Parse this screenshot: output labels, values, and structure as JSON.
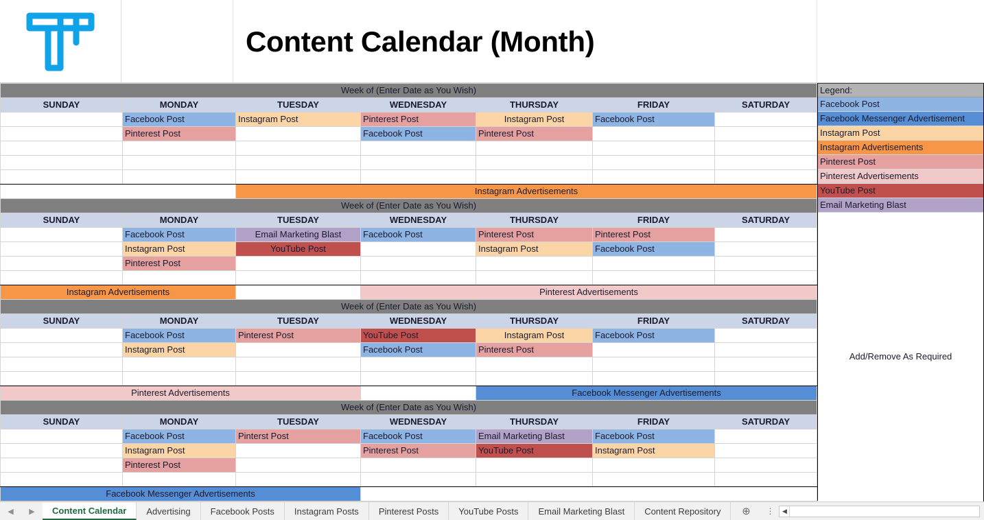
{
  "header": {
    "logo_icon": "tp-monogram-logo",
    "logo_color": "#11A3E8",
    "title": "Content Calendar (Month)"
  },
  "colors": {
    "facebook_post": "#8DB4E2",
    "facebook_messenger_ad": "#558ED5",
    "instagram_post": "#FBD5A5",
    "instagram_ad": "#F79646",
    "pinterest_post": "#E5A0A0",
    "pinterest_ad": "#F2C9C9",
    "youtube_post": "#C0504D",
    "email_blast": "#B2A2C7",
    "week_bar": "#808080",
    "day_header": "#CCD5E8",
    "legend_header": "#B3B3B3",
    "empty": "#FFFFFF"
  },
  "calendar": {
    "week_of_label": "Week of (Enter Date as You Wish)",
    "day_names": [
      "SUNDAY",
      "MONDAY",
      "TUESDAY",
      "WEDNESDAY",
      "THURSDAY",
      "FRIDAY",
      "SATURDAY"
    ],
    "weeks": [
      {
        "rows": [
          [
            {
              "text": "",
              "fill": "empty",
              "align": "left"
            },
            {
              "text": "Facebook Post",
              "fill": "facebook_post",
              "align": "left"
            },
            {
              "text": "Instagram Post",
              "fill": "instagram_post",
              "align": "left"
            },
            {
              "text": "Pinterest Post",
              "fill": "pinterest_post",
              "align": "left"
            },
            {
              "text": "Instagram Post",
              "fill": "instagram_post",
              "align": "center"
            },
            {
              "text": "Facebook Post",
              "fill": "facebook_post",
              "align": "left"
            },
            {
              "text": "",
              "fill": "empty",
              "align": "left"
            }
          ],
          [
            {
              "text": "",
              "fill": "empty",
              "align": "left"
            },
            {
              "text": "Pinterest Post",
              "fill": "pinterest_post",
              "align": "left"
            },
            {
              "text": "",
              "fill": "empty",
              "align": "left"
            },
            {
              "text": "Facebook Post",
              "fill": "facebook_post",
              "align": "left"
            },
            {
              "text": "Pinterest Post",
              "fill": "pinterest_post",
              "align": "left"
            },
            {
              "text": "",
              "fill": "empty",
              "align": "left"
            },
            {
              "text": "",
              "fill": "empty",
              "align": "left"
            }
          ],
          [
            {
              "text": "",
              "fill": "empty",
              "align": "left"
            },
            {
              "text": "",
              "fill": "empty",
              "align": "left"
            },
            {
              "text": "",
              "fill": "empty",
              "align": "left"
            },
            {
              "text": "",
              "fill": "empty",
              "align": "left"
            },
            {
              "text": "",
              "fill": "empty",
              "align": "left"
            },
            {
              "text": "",
              "fill": "empty",
              "align": "left"
            },
            {
              "text": "",
              "fill": "empty",
              "align": "left"
            }
          ],
          [
            {
              "text": "",
              "fill": "empty",
              "align": "left"
            },
            {
              "text": "",
              "fill": "empty",
              "align": "left"
            },
            {
              "text": "",
              "fill": "empty",
              "align": "left"
            },
            {
              "text": "",
              "fill": "empty",
              "align": "left"
            },
            {
              "text": "",
              "fill": "empty",
              "align": "left"
            },
            {
              "text": "",
              "fill": "empty",
              "align": "left"
            },
            {
              "text": "",
              "fill": "empty",
              "align": "left"
            }
          ],
          [
            {
              "text": "",
              "fill": "empty",
              "align": "left"
            },
            {
              "text": "",
              "fill": "empty",
              "align": "left"
            },
            {
              "text": "",
              "fill": "empty",
              "align": "left"
            },
            {
              "text": "",
              "fill": "empty",
              "align": "left"
            },
            {
              "text": "",
              "fill": "empty",
              "align": "left"
            },
            {
              "text": "",
              "fill": "empty",
              "align": "left"
            },
            {
              "text": "",
              "fill": "empty",
              "align": "left"
            }
          ]
        ],
        "ad_bars": [
          {
            "text": "",
            "fill": "empty",
            "start": 0,
            "span": 2
          },
          {
            "text": "Instagram Advertisements",
            "fill": "instagram_ad",
            "start": 2,
            "span": 5
          }
        ]
      },
      {
        "rows": [
          [
            {
              "text": "",
              "fill": "empty",
              "align": "left"
            },
            {
              "text": "Facebook Post",
              "fill": "facebook_post",
              "align": "left"
            },
            {
              "text": "Email Marketing Blast",
              "fill": "email_blast",
              "align": "center"
            },
            {
              "text": "Facebook Post",
              "fill": "facebook_post",
              "align": "left"
            },
            {
              "text": "Pinterest Post",
              "fill": "pinterest_post",
              "align": "left"
            },
            {
              "text": "Pinterest Post",
              "fill": "pinterest_post",
              "align": "left"
            },
            {
              "text": "",
              "fill": "empty",
              "align": "left"
            }
          ],
          [
            {
              "text": "",
              "fill": "empty",
              "align": "left"
            },
            {
              "text": "Instagram Post",
              "fill": "instagram_post",
              "align": "left"
            },
            {
              "text": "YouTube Post",
              "fill": "youtube_post",
              "align": "center"
            },
            {
              "text": "",
              "fill": "empty",
              "align": "left"
            },
            {
              "text": "Instagram Post",
              "fill": "instagram_post",
              "align": "left"
            },
            {
              "text": "Facebook Post",
              "fill": "facebook_post",
              "align": "left"
            },
            {
              "text": "",
              "fill": "empty",
              "align": "left"
            }
          ],
          [
            {
              "text": "",
              "fill": "empty",
              "align": "left"
            },
            {
              "text": "Pinterest Post",
              "fill": "pinterest_post",
              "align": "left"
            },
            {
              "text": "",
              "fill": "empty",
              "align": "left"
            },
            {
              "text": "",
              "fill": "empty",
              "align": "left"
            },
            {
              "text": "",
              "fill": "empty",
              "align": "left"
            },
            {
              "text": "",
              "fill": "empty",
              "align": "left"
            },
            {
              "text": "",
              "fill": "empty",
              "align": "left"
            }
          ],
          [
            {
              "text": "",
              "fill": "empty",
              "align": "left"
            },
            {
              "text": "",
              "fill": "empty",
              "align": "left"
            },
            {
              "text": "",
              "fill": "empty",
              "align": "left"
            },
            {
              "text": "",
              "fill": "empty",
              "align": "left"
            },
            {
              "text": "",
              "fill": "empty",
              "align": "left"
            },
            {
              "text": "",
              "fill": "empty",
              "align": "left"
            },
            {
              "text": "",
              "fill": "empty",
              "align": "left"
            }
          ]
        ],
        "ad_bars": [
          {
            "text": "Instagram Advertisements",
            "fill": "instagram_ad",
            "start": 0,
            "span": 2
          },
          {
            "text": "",
            "fill": "empty",
            "start": 2,
            "span": 1
          },
          {
            "text": "Pinterest Advertisements",
            "fill": "pinterest_ad",
            "start": 3,
            "span": 4
          }
        ]
      },
      {
        "rows": [
          [
            {
              "text": "",
              "fill": "empty",
              "align": "left"
            },
            {
              "text": "Facebook Post",
              "fill": "facebook_post",
              "align": "left"
            },
            {
              "text": "Pinterest Post",
              "fill": "pinterest_post",
              "align": "left"
            },
            {
              "text": "YouTube Post",
              "fill": "youtube_post",
              "align": "left"
            },
            {
              "text": "Instagram Post",
              "fill": "instagram_post",
              "align": "center"
            },
            {
              "text": "Facebook Post",
              "fill": "facebook_post",
              "align": "left"
            },
            {
              "text": "",
              "fill": "empty",
              "align": "left"
            }
          ],
          [
            {
              "text": "",
              "fill": "empty",
              "align": "left"
            },
            {
              "text": "Instagram Post",
              "fill": "instagram_post",
              "align": "left"
            },
            {
              "text": "",
              "fill": "empty",
              "align": "left"
            },
            {
              "text": "Facebook Post",
              "fill": "facebook_post",
              "align": "left"
            },
            {
              "text": "Pinterest Post",
              "fill": "pinterest_post",
              "align": "left"
            },
            {
              "text": "",
              "fill": "empty",
              "align": "left"
            },
            {
              "text": "",
              "fill": "empty",
              "align": "left"
            }
          ],
          [
            {
              "text": "",
              "fill": "empty",
              "align": "left"
            },
            {
              "text": "",
              "fill": "empty",
              "align": "left"
            },
            {
              "text": "",
              "fill": "empty",
              "align": "left"
            },
            {
              "text": "",
              "fill": "empty",
              "align": "left"
            },
            {
              "text": "",
              "fill": "empty",
              "align": "left"
            },
            {
              "text": "",
              "fill": "empty",
              "align": "left"
            },
            {
              "text": "",
              "fill": "empty",
              "align": "left"
            }
          ],
          [
            {
              "text": "",
              "fill": "empty",
              "align": "left"
            },
            {
              "text": "",
              "fill": "empty",
              "align": "left"
            },
            {
              "text": "",
              "fill": "empty",
              "align": "left"
            },
            {
              "text": "",
              "fill": "empty",
              "align": "left"
            },
            {
              "text": "",
              "fill": "empty",
              "align": "left"
            },
            {
              "text": "",
              "fill": "empty",
              "align": "left"
            },
            {
              "text": "",
              "fill": "empty",
              "align": "left"
            }
          ]
        ],
        "ad_bars": [
          {
            "text": "Pinterest Advertisements",
            "fill": "pinterest_ad",
            "start": 0,
            "span": 3
          },
          {
            "text": "",
            "fill": "empty",
            "start": 3,
            "span": 1
          },
          {
            "text": "Facebook Messenger Advertisements",
            "fill": "facebook_messenger_ad",
            "start": 4,
            "span": 3
          }
        ]
      },
      {
        "rows": [
          [
            {
              "text": "",
              "fill": "empty",
              "align": "left"
            },
            {
              "text": "Facebook Post",
              "fill": "facebook_post",
              "align": "left"
            },
            {
              "text": "Pinterst Post",
              "fill": "pinterest_post",
              "align": "left"
            },
            {
              "text": "Facebook Post",
              "fill": "facebook_post",
              "align": "left"
            },
            {
              "text": "Email Marketing Blast",
              "fill": "email_blast",
              "align": "left"
            },
            {
              "text": "Facebook Post",
              "fill": "facebook_post",
              "align": "left"
            },
            {
              "text": "",
              "fill": "empty",
              "align": "left"
            }
          ],
          [
            {
              "text": "",
              "fill": "empty",
              "align": "left"
            },
            {
              "text": "Instagram Post",
              "fill": "instagram_post",
              "align": "left"
            },
            {
              "text": "",
              "fill": "empty",
              "align": "left"
            },
            {
              "text": "Pinterest Post",
              "fill": "pinterest_post",
              "align": "left"
            },
            {
              "text": "YouTube Post",
              "fill": "youtube_post",
              "align": "left"
            },
            {
              "text": "Instagram Post",
              "fill": "instagram_post",
              "align": "left"
            },
            {
              "text": "",
              "fill": "empty",
              "align": "left"
            }
          ],
          [
            {
              "text": "",
              "fill": "empty",
              "align": "left"
            },
            {
              "text": "Pinterest Post",
              "fill": "pinterest_post",
              "align": "left"
            },
            {
              "text": "",
              "fill": "empty",
              "align": "left"
            },
            {
              "text": "",
              "fill": "empty",
              "align": "left"
            },
            {
              "text": "",
              "fill": "empty",
              "align": "left"
            },
            {
              "text": "",
              "fill": "empty",
              "align": "left"
            },
            {
              "text": "",
              "fill": "empty",
              "align": "left"
            }
          ],
          [
            {
              "text": "",
              "fill": "empty",
              "align": "left"
            },
            {
              "text": "",
              "fill": "empty",
              "align": "left"
            },
            {
              "text": "",
              "fill": "empty",
              "align": "left"
            },
            {
              "text": "",
              "fill": "empty",
              "align": "left"
            },
            {
              "text": "",
              "fill": "empty",
              "align": "left"
            },
            {
              "text": "",
              "fill": "empty",
              "align": "left"
            },
            {
              "text": "",
              "fill": "empty",
              "align": "left"
            }
          ]
        ],
        "ad_bars": [
          {
            "text": "Facebook Messenger Advertisements",
            "fill": "facebook_messenger_ad",
            "start": 0,
            "span": 3
          },
          {
            "text": "",
            "fill": "empty",
            "start": 3,
            "span": 4
          }
        ]
      }
    ]
  },
  "legend": {
    "title": "Legend:",
    "items": [
      {
        "label": "Facebook Post",
        "fill": "facebook_post"
      },
      {
        "label": "Facebook Messenger Advertisement",
        "fill": "facebook_messenger_ad"
      },
      {
        "label": "Instagram Post",
        "fill": "instagram_post"
      },
      {
        "label": "Instagram Advertisements",
        "fill": "instagram_ad"
      },
      {
        "label": "Pinterest Post",
        "fill": "pinterest_post"
      },
      {
        "label": "Pinterest Advertisements",
        "fill": "pinterest_ad"
      },
      {
        "label": "YouTube Post",
        "fill": "youtube_post"
      },
      {
        "label": "Email Marketing Blast",
        "fill": "email_blast"
      }
    ],
    "note": "Add/Remove As Required"
  },
  "tabbar": {
    "prev_icon": "chevron-left-icon",
    "next_icon": "chevron-right-icon",
    "tabs": [
      {
        "label": "Content Calendar",
        "active": true
      },
      {
        "label": "Advertising",
        "active": false
      },
      {
        "label": "Facebook Posts",
        "active": false
      },
      {
        "label": "Instagram Posts",
        "active": false
      },
      {
        "label": "Pinterest Posts",
        "active": false
      },
      {
        "label": "YouTube Posts",
        "active": false
      },
      {
        "label": "Email Marketing Blast",
        "active": false
      },
      {
        "label": "Content Repository",
        "active": false
      }
    ],
    "add_sheet_icon": "plus-circle-icon",
    "overflow_icon": "vertical-dots-icon",
    "scroll_left_icon": "scroll-left-icon"
  }
}
